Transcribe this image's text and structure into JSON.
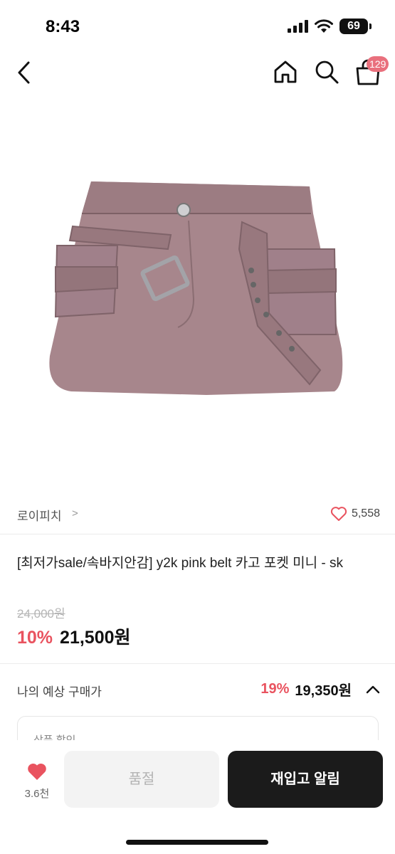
{
  "status_bar": {
    "time": "8:43",
    "battery": "69"
  },
  "header": {
    "cart_count": "129",
    "icons": [
      "back-arrow-icon",
      "home-icon",
      "search-icon",
      "shopping-bag-icon"
    ]
  },
  "product_image": {
    "subject": "pink cargo mini skirt with belt"
  },
  "brand": {
    "name": "로이피치",
    "chevron": ">",
    "likes": "5,558"
  },
  "product": {
    "title": "[최저가sale/속바지안감] y2k pink belt 카고 포켓 미니 - sk",
    "original_price": "24,000원",
    "discount_rate": "10%",
    "sale_price": "21,500원"
  },
  "expected_price": {
    "label": "나의 예상 구매가",
    "rate": "19%",
    "price": "19,350원"
  },
  "benefit": {
    "label": "상품 할인"
  },
  "bottom_bar": {
    "wish_count": "3.6천",
    "soldout_label": "품절",
    "restock_label": "재입고 알림"
  },
  "colors": {
    "accent": "#e9535f",
    "badge": "#e9707d",
    "dark_button": "#1b1b1b"
  }
}
